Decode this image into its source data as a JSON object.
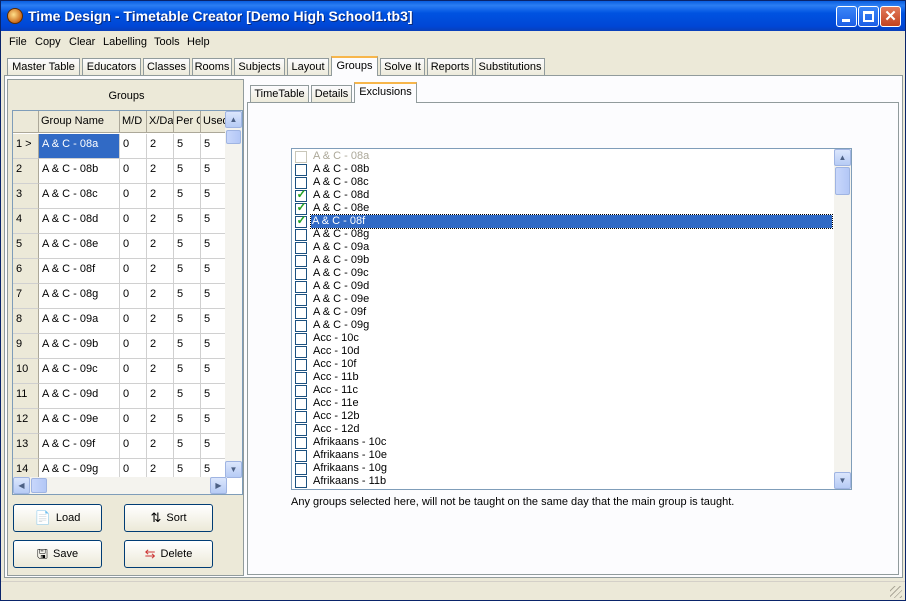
{
  "window": {
    "title": "Time Design - Timetable Creator [Demo High School1.tb3]"
  },
  "menu": [
    "File",
    "Copy",
    "Clear",
    "Labelling",
    "Tools",
    "Help"
  ],
  "main_tabs": [
    "Master Table",
    "Educators",
    "Classes",
    "Rooms",
    "Subjects",
    "Layout",
    "Groups",
    "Solve It",
    "Reports",
    "Substitutions"
  ],
  "active_main_tab": "Groups",
  "left": {
    "title": "Groups",
    "columns": [
      "",
      "Group Name",
      "M/D",
      "X/Da",
      "Per C",
      "Used"
    ],
    "rows": [
      [
        "1 >",
        "A & C - 08a",
        "0",
        "2",
        "5",
        "5"
      ],
      [
        "2",
        "A & C - 08b",
        "0",
        "2",
        "5",
        "5"
      ],
      [
        "3",
        "A & C - 08c",
        "0",
        "2",
        "5",
        "5"
      ],
      [
        "4",
        "A & C - 08d",
        "0",
        "2",
        "5",
        "5"
      ],
      [
        "5",
        "A & C - 08e",
        "0",
        "2",
        "5",
        "5"
      ],
      [
        "6",
        "A & C - 08f",
        "0",
        "2",
        "5",
        "5"
      ],
      [
        "7",
        "A & C - 08g",
        "0",
        "2",
        "5",
        "5"
      ],
      [
        "8",
        "A & C - 09a",
        "0",
        "2",
        "5",
        "5"
      ],
      [
        "9",
        "A & C - 09b",
        "0",
        "2",
        "5",
        "5"
      ],
      [
        "10",
        "A & C - 09c",
        "0",
        "2",
        "5",
        "5"
      ],
      [
        "11",
        "A & C - 09d",
        "0",
        "2",
        "5",
        "5"
      ],
      [
        "12",
        "A & C - 09e",
        "0",
        "2",
        "5",
        "5"
      ],
      [
        "13",
        "A & C - 09f",
        "0",
        "2",
        "5",
        "5"
      ],
      [
        "14",
        "A & C - 09g",
        "0",
        "2",
        "5",
        "5"
      ]
    ],
    "buttons": {
      "load": "Load",
      "sort": "Sort",
      "save": "Save",
      "delete": "Delete"
    }
  },
  "sub_tabs": [
    "TimeTable",
    "Details",
    "Exclusions"
  ],
  "active_sub_tab": "Exclusions",
  "exclusions": {
    "items": [
      {
        "label": "A & C - 08a",
        "checked": false,
        "disabled": true
      },
      {
        "label": "A & C - 08b",
        "checked": false
      },
      {
        "label": "A & C - 08c",
        "checked": false
      },
      {
        "label": "A & C - 08d",
        "checked": true
      },
      {
        "label": "A & C - 08e",
        "checked": true
      },
      {
        "label": "A & C - 08f",
        "checked": true,
        "highlighted": true
      },
      {
        "label": "A & C - 08g",
        "checked": false
      },
      {
        "label": "A & C - 09a",
        "checked": false
      },
      {
        "label": "A & C - 09b",
        "checked": false
      },
      {
        "label": "A & C - 09c",
        "checked": false
      },
      {
        "label": "A & C - 09d",
        "checked": false
      },
      {
        "label": "A & C - 09e",
        "checked": false
      },
      {
        "label": "A & C - 09f",
        "checked": false
      },
      {
        "label": "A & C - 09g",
        "checked": false
      },
      {
        "label": "Acc - 10c",
        "checked": false
      },
      {
        "label": "Acc - 10d",
        "checked": false
      },
      {
        "label": "Acc - 10f",
        "checked": false
      },
      {
        "label": "Acc - 11b",
        "checked": false
      },
      {
        "label": "Acc - 11c",
        "checked": false
      },
      {
        "label": "Acc - 11e",
        "checked": false
      },
      {
        "label": "Acc - 12b",
        "checked": false
      },
      {
        "label": "Acc - 12d",
        "checked": false
      },
      {
        "label": "Afrikaans - 10c",
        "checked": false
      },
      {
        "label": "Afrikaans - 10e",
        "checked": false
      },
      {
        "label": "Afrikaans - 10g",
        "checked": false
      },
      {
        "label": "Afrikaans - 11b",
        "checked": false
      }
    ],
    "note": "Any groups selected here, will not be taught on the same day that the main group is taught."
  },
  "colors": {
    "titlebar": "#0053e1",
    "selection": "#316ac5",
    "check": "#21a121",
    "active_tab_accent": "#f7b64b"
  }
}
